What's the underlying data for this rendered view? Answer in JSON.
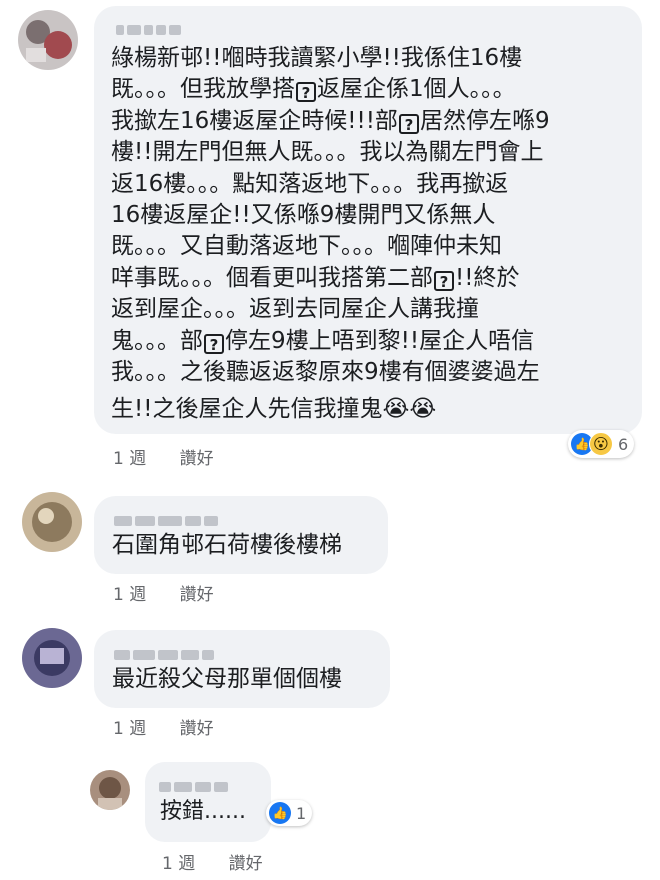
{
  "comments": [
    {
      "lines": [
        [
          "綠楊新邨!!嗰時我讀緊小學!!我係住16樓"
        ],
        [
          "既。。。但我放學搭",
          "?",
          "返屋企係1個人。。。"
        ],
        [
          "我撳左16樓返屋企時候!!!部",
          "?",
          "居然停左喺9"
        ],
        [
          "樓!!開左門但無人既。。。我以為關左門會上"
        ],
        [
          "返16樓。。。點知落返地下。。。我再撳返"
        ],
        [
          "16樓返屋企!!又係喺9樓開門又係無人"
        ],
        [
          "既。。。又自動落返地下。。。嗰陣仲未知"
        ],
        [
          "咩事既。。。個看更叫我搭第二部",
          "?",
          "!!終於"
        ],
        [
          "返到屋企。。。返到去同屋企人講我撞"
        ],
        [
          "鬼。。。部",
          "?",
          "停左9樓上唔到黎!!屋企人唔信"
        ],
        [
          "我。。。之後聽返返黎原來9樓有個婆婆過左"
        ],
        [
          "生!!之後屋企人先信我撞鬼😭😭"
        ]
      ],
      "time": "1 週",
      "like": "讚好",
      "reaction_count": "6"
    },
    {
      "text": "石圍角邨石荷樓後樓梯",
      "time": "1 週",
      "like": "讚好"
    },
    {
      "text": "最近殺父母那單個個樓",
      "time": "1 週",
      "like": "讚好"
    },
    {
      "text": "按錯......",
      "time": "1 週",
      "like": "讚好",
      "reaction_count": "1"
    }
  ],
  "icons": {
    "like": "thumbs-up-icon",
    "wow": "wow-face-icon",
    "unknown_glyph": "question-box-icon"
  },
  "colors": {
    "bubble": "#f0f2f5",
    "meta": "#65676b",
    "like_blue": "#1877f2",
    "wow_yellow": "#f7c844"
  }
}
